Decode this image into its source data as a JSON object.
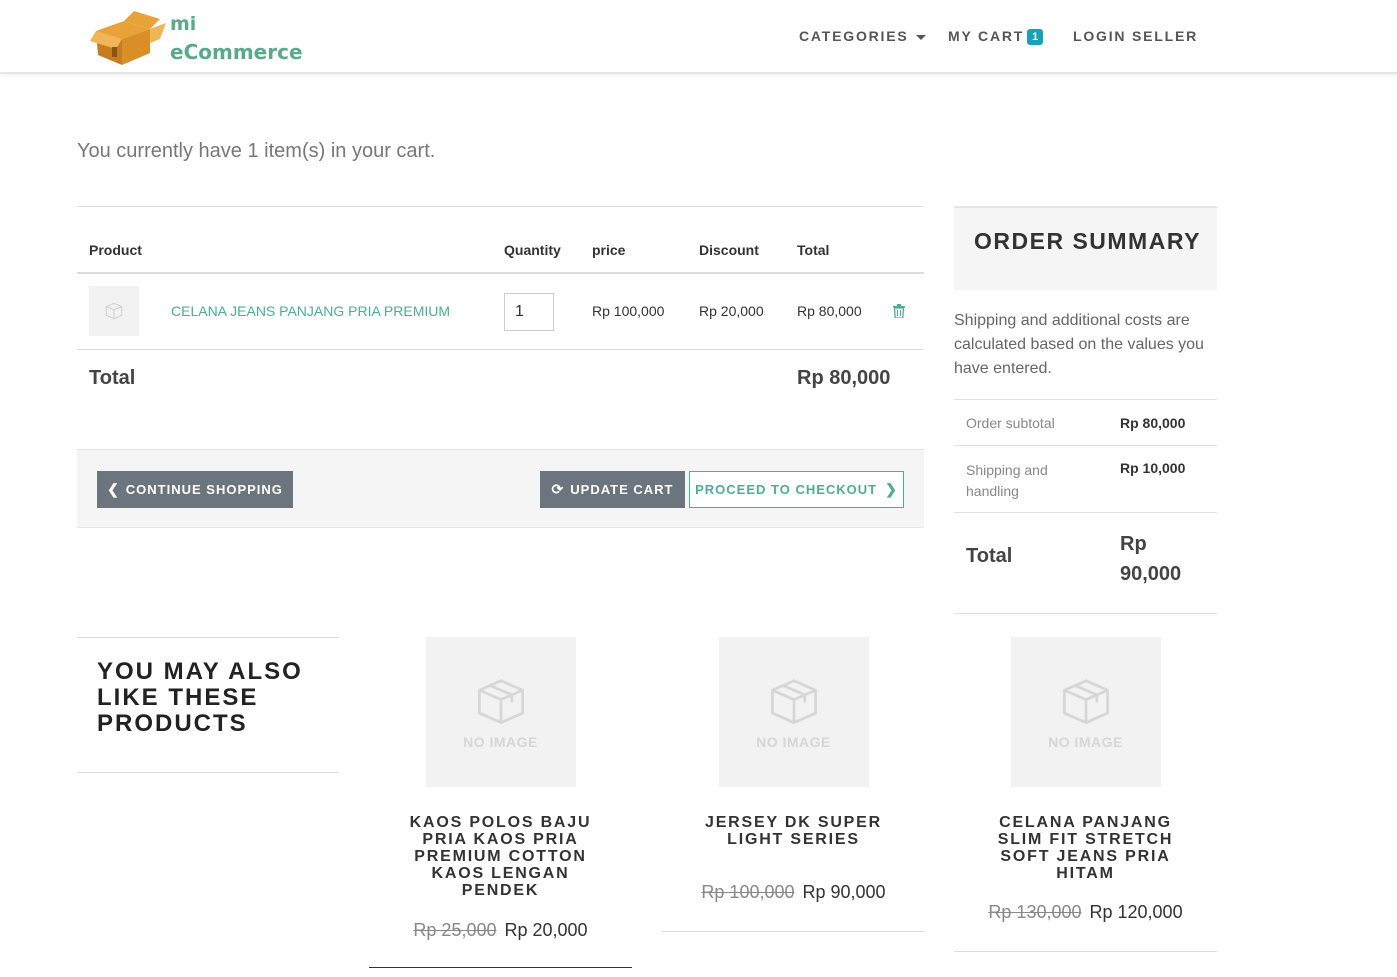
{
  "header": {
    "logo_line1": "mi",
    "logo_line2": "eCommerce",
    "nav_categories": "CATEGORIES",
    "nav_cart": "MY CART",
    "cart_count": "1",
    "nav_login": "LOGIN SELLER"
  },
  "cart": {
    "intro": "You currently have 1 item(s) in your cart.",
    "headers": {
      "product": "Product",
      "quantity": "Quantity",
      "price": "price",
      "discount": "Discount",
      "total": "Total"
    },
    "items": [
      {
        "name": "CELANA JEANS PANJANG PRIA PREMIUM",
        "quantity": "1",
        "price": "Rp 100,000",
        "discount": "Rp 20,000",
        "total": "Rp 80,000"
      }
    ],
    "total_label": "Total",
    "total_value": "Rp 80,000",
    "continue_label": "CONTINUE SHOPPING",
    "update_label": "UPDATE CART",
    "checkout_label": "PROCEED TO CHECKOUT"
  },
  "summary": {
    "title": "ORDER SUMMARY",
    "note": "Shipping and additional costs are calculated based on the values you have entered.",
    "subtotal_label": "Order subtotal",
    "subtotal_value": "Rp 80,000",
    "shipping_label": "Shipping and handling",
    "shipping_value": "Rp 10,000",
    "total_label": "Total",
    "total_value": "Rp 90,000"
  },
  "related": {
    "heading": "YOU MAY ALSO LIKE THESE PRODUCTS",
    "no_image_text": "NO IMAGE",
    "products": [
      {
        "name": "KAOS POLOS BAJU PRIA KAOS PRIA PREMIUM COTTON KAOS LENGAN PENDEK",
        "old_price": "Rp 25,000",
        "price": "Rp 20,000"
      },
      {
        "name": "JERSEY DK SUPER LIGHT SERIES",
        "old_price": "Rp 100,000",
        "price": "Rp 90,000"
      },
      {
        "name": "CELANA PANJANG SLIM FIT STRETCH SOFT JEANS PRIA HITAM",
        "old_price": "Rp 130,000",
        "price": "Rp 120,000"
      }
    ]
  },
  "colors": {
    "accent": "#4caf93",
    "badge": "#17a2b8",
    "button_gray": "#6c757d"
  }
}
